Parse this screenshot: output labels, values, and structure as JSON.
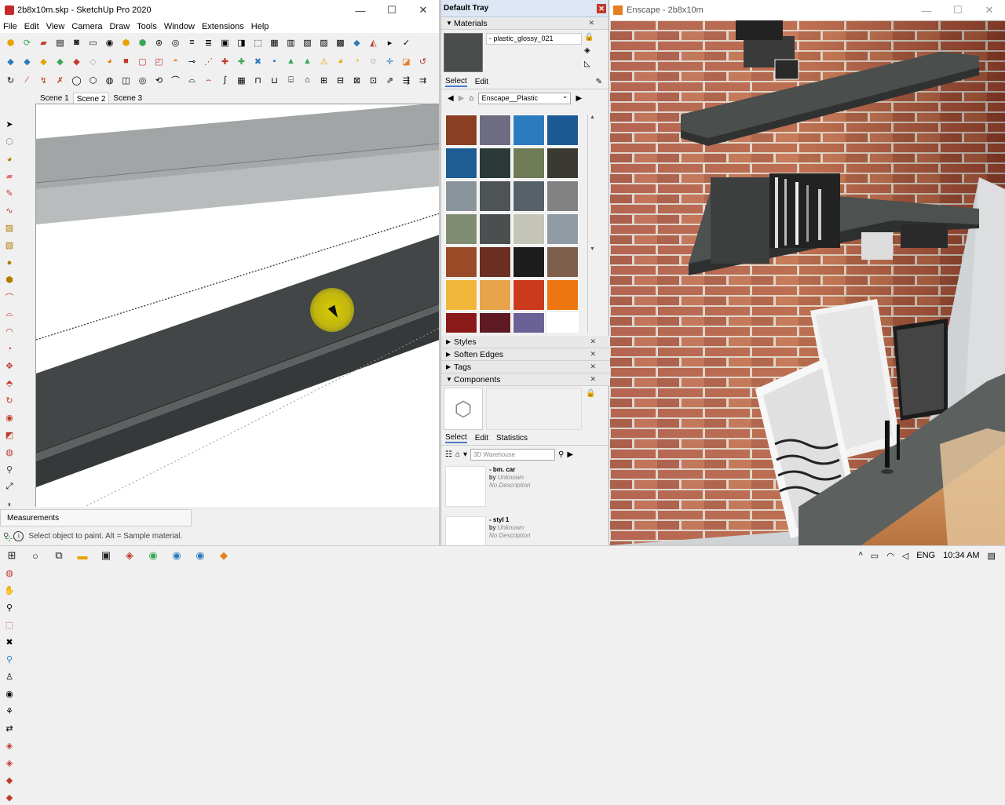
{
  "sketchup": {
    "title": "2b8x10m.skp - SketchUp Pro 2020",
    "menu": [
      "File",
      "Edit",
      "View",
      "Camera",
      "Draw",
      "Tools",
      "Window",
      "Extensions",
      "Help"
    ],
    "scenes": [
      "Scene 1",
      "Scene 2",
      "Scene 3"
    ],
    "active_scene": "Scene 2",
    "measurements_label": "Measurements",
    "status_text": "Select object to paint. Alt = Sample material."
  },
  "tray": {
    "title": "Default Tray",
    "materials_header": "Materials",
    "material_name": "- plastic_glossy_021",
    "select_tab": "Select",
    "edit_tab": "Edit",
    "collection": "Enscape__Plastic",
    "swatches": [
      "#8a3f22",
      "#6d6c82",
      "#2d7bbf",
      "#1c5a96",
      "#1d5d94",
      "#2b3a38",
      "#6f7a56",
      "#3a3a32",
      "#8a949c",
      "#4e5356",
      "#566169",
      "#828282",
      "#7f8c72",
      "#4b4f4f",
      "#c4c4b7",
      "#8f9aa3",
      "#9a4a26",
      "#6a2e22",
      "#1d1d1d",
      "#7d5f4b",
      "#f2b63a",
      "#e8a44a",
      "#cc3a1d",
      "#ee7610",
      "#8a1a1a",
      "#5e1a22",
      "#6a6296",
      "#ffffff"
    ],
    "styles": "Styles",
    "soften_edges": "Soften Edges",
    "tags": "Tags",
    "components": "Components",
    "comp_tabs": [
      "Select",
      "Edit",
      "Statistics"
    ],
    "search_placeholder": "3D Warehouse",
    "components_list": [
      {
        "name": "- bm. car",
        "by": "by",
        "author": "Unknown",
        "desc": "No Description"
      },
      {
        "name": "- styl 1",
        "by": "by",
        "author": "Unknown",
        "desc": "No Description"
      }
    ]
  },
  "enscape": {
    "title": "Enscape - 2b8x10m"
  },
  "taskbar": {
    "lang": "ENG",
    "time": "10:34 AM"
  }
}
